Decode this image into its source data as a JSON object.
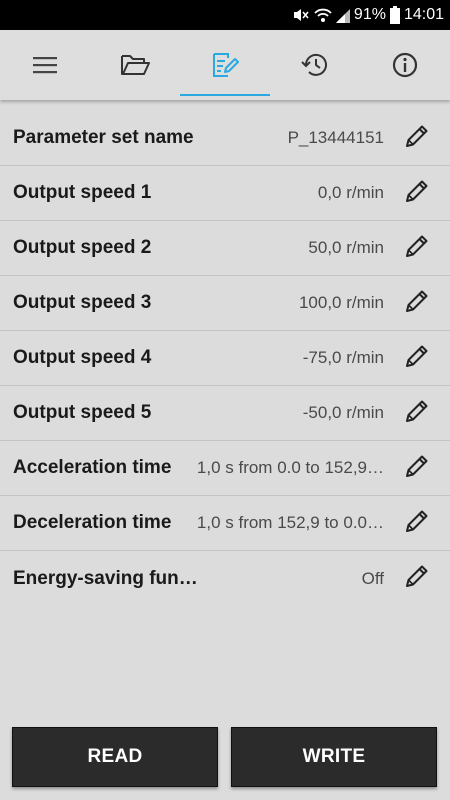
{
  "status_bar": {
    "battery_percent": "91%",
    "time": "14:01",
    "icons": [
      "mute-icon",
      "wifi-icon",
      "signal-icon",
      "battery-icon"
    ]
  },
  "tabs": [
    {
      "icon": "menu-icon",
      "active": false
    },
    {
      "icon": "folder-open-icon",
      "active": false
    },
    {
      "icon": "edit-list-icon",
      "active": true
    },
    {
      "icon": "history-icon",
      "active": false
    },
    {
      "icon": "info-icon",
      "active": false
    }
  ],
  "accent_color": "#2aa9e0",
  "parameters": [
    {
      "label": "Parameter set name",
      "value": "P_13444151"
    },
    {
      "label": "Output speed 1",
      "value": "0,0 r/min"
    },
    {
      "label": "Output speed 2",
      "value": "50,0 r/min"
    },
    {
      "label": "Output speed 3",
      "value": "100,0 r/min"
    },
    {
      "label": "Output speed 4",
      "value": "-75,0 r/min"
    },
    {
      "label": "Output speed 5",
      "value": "-50,0 r/min"
    },
    {
      "label": "Acceleration time",
      "value": "1,0 s from 0.0 to 152,9…"
    },
    {
      "label": "Deceleration time",
      "value": "1,0 s from 152,9 to 0.0…"
    },
    {
      "label": "Energy-saving fun…",
      "value": "Off"
    }
  ],
  "buttons": {
    "read_label": "READ",
    "write_label": "WRITE"
  }
}
